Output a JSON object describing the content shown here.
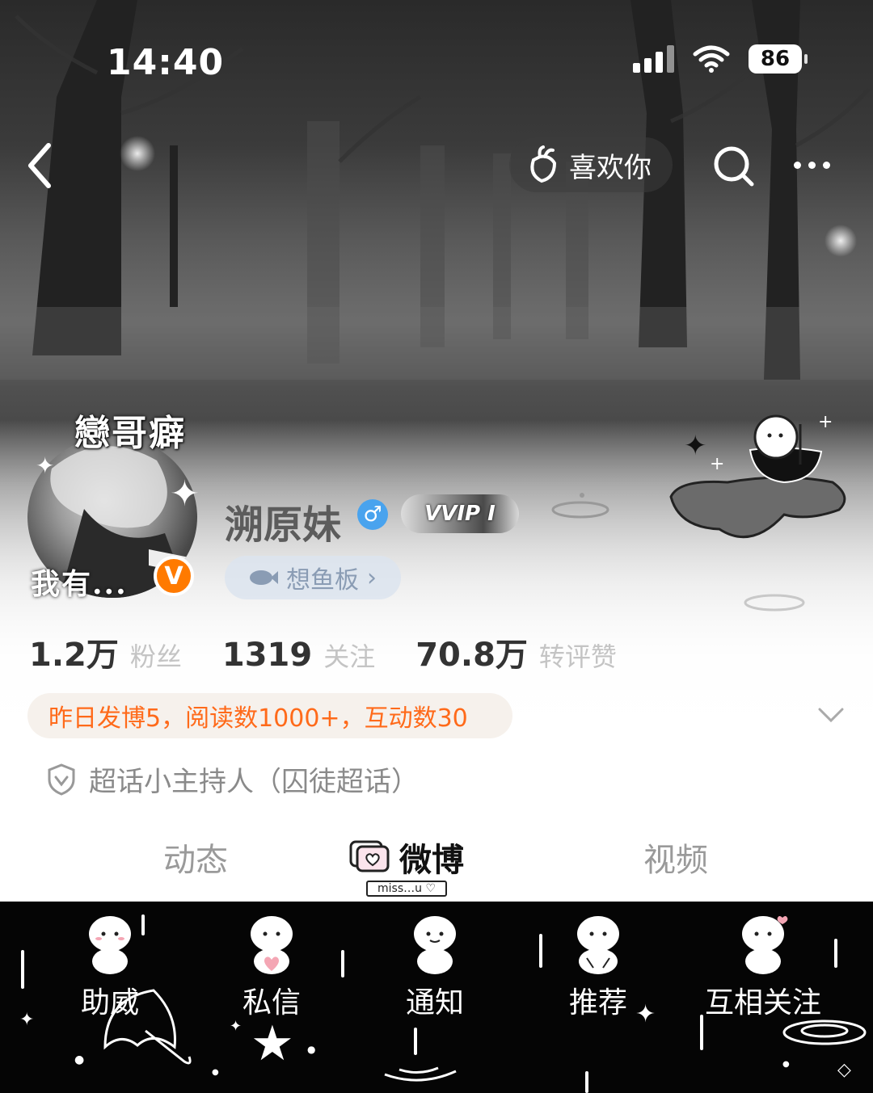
{
  "status_bar": {
    "time": "14:40",
    "battery": "86"
  },
  "nav": {
    "like_label": "喜欢你",
    "icons": [
      "back-icon",
      "carrot-icon",
      "search-icon",
      "more-icon"
    ]
  },
  "profile": {
    "avatar_text_top": "戀哥癖",
    "avatar_text_bottom": "我有...",
    "verified_badge": "V",
    "name": "溯原妹",
    "gender_symbol": "♂",
    "vip_label": "VVIP I",
    "fish_label": "想鱼板",
    "fish_arrow": "›"
  },
  "stats": [
    {
      "value": "1.2万",
      "label": "粉丝"
    },
    {
      "value": "1319",
      "label": "关注"
    },
    {
      "value": "70.8万",
      "label": "转评赞"
    }
  ],
  "activity_text": "昨日发博5，阅读数1000+，互动数30",
  "topic_text": "超话小主持人（囚徒超话）",
  "tabs": [
    {
      "label": "动态"
    },
    {
      "label": "微博",
      "badge": "miss…u ♡",
      "active": true
    },
    {
      "label": "视频"
    }
  ],
  "actions": [
    {
      "label": "助威"
    },
    {
      "label": "私信"
    },
    {
      "label": "通知"
    },
    {
      "label": "推荐"
    },
    {
      "label": "互相关注"
    }
  ],
  "colors": {
    "accent_orange": "#ff6a1a",
    "verified_orange": "#ff7a00",
    "gender_blue": "#49a3ee",
    "bottom_bar": "#050505"
  }
}
